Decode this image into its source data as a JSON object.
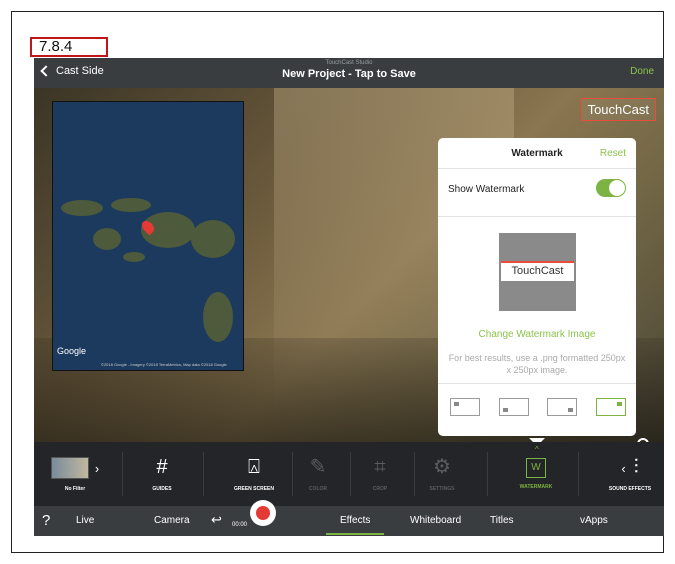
{
  "section_label": "7.8.4",
  "header": {
    "back_label": "Cast Side",
    "studio_name": "TouchCast Studio",
    "project_title": "New Project - Tap to Save",
    "done_label": "Done"
  },
  "stage": {
    "logo_text": "TouchCast",
    "map": {
      "logo": "Google",
      "credits": "©2018 Google - Imagery ©2018 TerraMetrics, Map data ©2018 Google"
    }
  },
  "watermark_panel": {
    "title": "Watermark",
    "reset_label": "Reset",
    "show_label": "Show Watermark",
    "show_enabled": true,
    "thumb_text": "TouchCast",
    "change_label": "Change Watermark Image",
    "hint": "For best results, use a .png formatted 250px x 250px image.",
    "positions": [
      "top-left",
      "bottom-left",
      "bottom-right",
      "top-right"
    ],
    "selected_position": "top-right"
  },
  "toolbar": {
    "items": [
      {
        "label": "No Filter",
        "icon": "filter-thumbnail-icon"
      },
      {
        "label": "GUIDES",
        "icon": "grid-icon"
      },
      {
        "label": "GREEN SCREEN",
        "icon": "green-screen-icon"
      },
      {
        "label": "COLOR",
        "icon": "pen-icon"
      },
      {
        "label": "CROP",
        "icon": "crop-icon"
      },
      {
        "label": "SETTINGS",
        "icon": "gear-icon"
      },
      {
        "label": "WATERMARK",
        "icon": "watermark-icon"
      },
      {
        "label": "SOUND EFFECTS",
        "icon": "sliders-icon"
      }
    ],
    "watermark_glyph": "W"
  },
  "tabbar": {
    "help": "?",
    "timer": "00:00",
    "tabs": [
      "Live",
      "Camera",
      "Effects",
      "Whiteboard",
      "Titles",
      "vApps"
    ],
    "active_tab": "Effects"
  },
  "colors": {
    "accent_green": "#7cb342",
    "record_red": "#e53935",
    "logo_red": "#e74c3c"
  }
}
